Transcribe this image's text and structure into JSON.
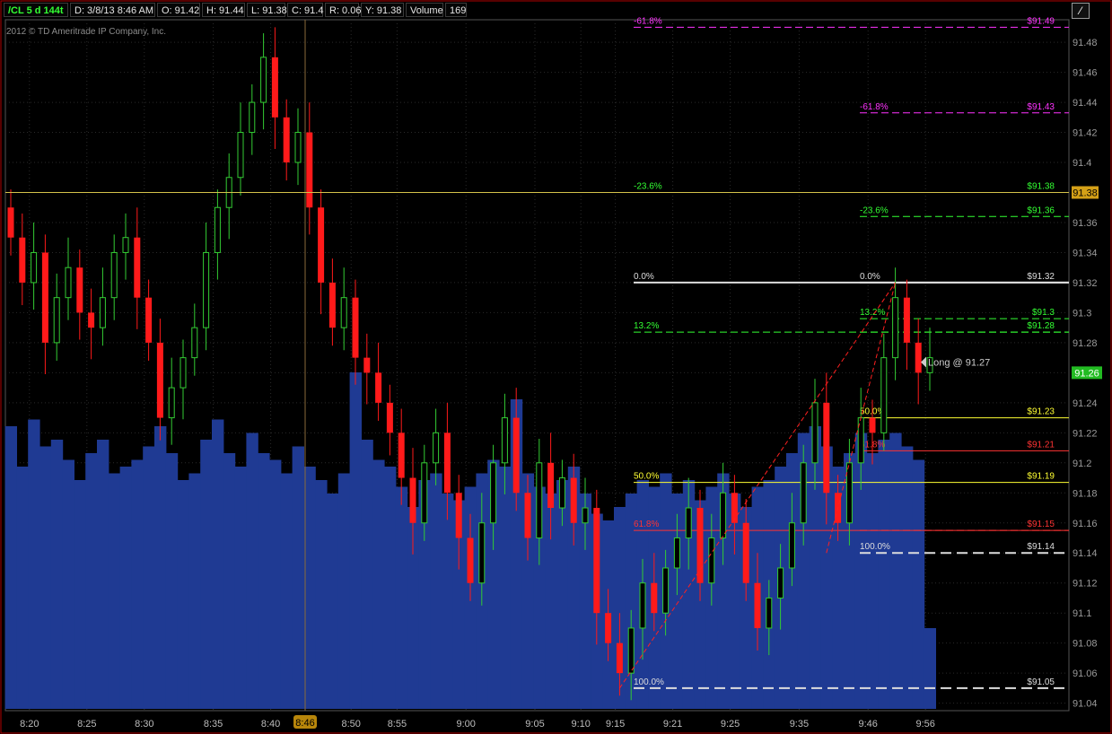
{
  "header": {
    "symbol": "/CL 5 d 144t",
    "fields": [
      "D: 3/8/13 8:46 AM",
      "O: 91.42",
      "H: 91.44",
      "L: 91.38",
      "C: 91.4",
      "R: 0.06",
      "Y: 91.38",
      "Volume",
      "169"
    ]
  },
  "copyright": "2012 © TD Ameritrade IP Company, Inc.",
  "chart_data": {
    "type": "candlestick",
    "y_range": [
      91.035,
      91.495
    ],
    "y_ticks": [
      "91.48",
      "91.46",
      "91.44",
      "91.42",
      "91.4",
      "91.38",
      "91.36",
      "91.34",
      "91.32",
      "91.3",
      "91.28",
      "91.26",
      "91.24",
      "91.22",
      "91.2",
      "91.18",
      "91.16",
      "91.14",
      "91.12",
      "91.1",
      "91.08",
      "91.06",
      "91.04"
    ],
    "x_ticks": [
      "8:20",
      "8:25",
      "8:30",
      "8:35",
      "8:40",
      "8:50",
      "8:55",
      "9:00",
      "9:05",
      "9:10",
      "9:15",
      "9:21",
      "9:25",
      "9:35",
      "9:46",
      "9:56"
    ],
    "cursor_time": "8:46",
    "last_price": "91.38",
    "position_price": "91.26",
    "annotation": "Long @ 91.27",
    "colors": {
      "up": "#33cc33",
      "down": "#ff1a1a",
      "volume": "#1f3a93",
      "background": "#000000"
    },
    "closes": [
      91.35,
      91.32,
      91.34,
      91.28,
      91.31,
      91.33,
      91.3,
      91.29,
      91.31,
      91.34,
      91.35,
      91.31,
      91.28,
      91.23,
      91.25,
      91.27,
      91.29,
      91.34,
      91.37,
      91.39,
      91.42,
      91.44,
      91.47,
      91.43,
      91.4,
      91.42,
      91.37,
      91.32,
      91.29,
      91.31,
      91.27,
      91.26,
      91.24,
      91.22,
      91.19,
      91.16,
      91.2,
      91.22,
      91.18,
      91.15,
      91.12,
      91.16,
      91.2,
      91.23,
      91.18,
      91.15,
      91.2,
      91.17,
      91.19,
      91.16,
      91.17,
      91.1,
      91.08,
      91.06,
      91.09,
      91.12,
      91.1,
      91.13,
      91.15,
      91.17,
      91.12,
      91.15,
      91.18,
      91.16,
      91.12,
      91.09,
      91.11,
      91.13,
      91.16,
      91.2,
      91.24,
      91.18,
      91.16,
      91.2,
      91.23,
      91.22,
      91.27,
      91.31,
      91.28,
      91.26,
      91.27
    ],
    "volumes": [
      210,
      180,
      215,
      195,
      200,
      185,
      170,
      190,
      200,
      175,
      180,
      185,
      195,
      210,
      190,
      170,
      175,
      200,
      215,
      190,
      180,
      205,
      190,
      185,
      175,
      195,
      180,
      170,
      160,
      175,
      250,
      200,
      185,
      180,
      165,
      150,
      170,
      175,
      160,
      155,
      165,
      175,
      185,
      180,
      230,
      175,
      165,
      160,
      170,
      180,
      160,
      145,
      140,
      150,
      160,
      170,
      165,
      175,
      160,
      170,
      155,
      165,
      175,
      160,
      150,
      165,
      170,
      180,
      190,
      205,
      210,
      195,
      180,
      190,
      205,
      190,
      200,
      205,
      195,
      185,
      60
    ],
    "fib_left": {
      "levels": [
        {
          "pct": "-61.8%",
          "price": "$91.49",
          "color": "#ff33ff"
        },
        {
          "pct": "-23.6%",
          "price": "$91.38",
          "color": "#33ff33"
        },
        {
          "pct": "0.0%",
          "price": "$91.32",
          "color": "#dddddd"
        },
        {
          "pct": "13.2%",
          "price": "",
          "color": "#33ff33"
        },
        {
          "pct": "50.0%",
          "price": "$91.19",
          "color": "#ffff33"
        },
        {
          "pct": "61.8%",
          "price": "",
          "color": "#ff3333"
        },
        {
          "pct": "100.0%",
          "price": "$91.05",
          "color": "#dddddd"
        }
      ],
      "values": [
        91.49,
        91.38,
        91.32,
        91.287,
        91.187,
        91.155,
        91.05
      ]
    },
    "fib_right": {
      "levels": [
        {
          "pct": "-61.8%",
          "price": "$91.43",
          "color": "#ff33ff"
        },
        {
          "pct": "-23.6%",
          "price": "$91.36",
          "color": "#33ff33"
        },
        {
          "pct": "0.0%",
          "price": "",
          "color": "#dddddd"
        },
        {
          "pct": "13.2%",
          "price": "$91.3",
          "color": "#33ff33"
        },
        {
          "pct": "",
          "price": "$91.28",
          "color": "#33ff33"
        },
        {
          "pct": "50.0%",
          "price": "$91.23",
          "color": "#ffff33"
        },
        {
          "pct": "61.8%",
          "price": "$91.21",
          "color": "#ff3333"
        },
        {
          "pct": "",
          "price": "$91.15",
          "color": "#ff3333"
        },
        {
          "pct": "100.0%",
          "price": "$91.14",
          "color": "#dddddd"
        }
      ],
      "values": [
        91.433,
        91.364,
        91.32,
        91.296,
        91.287,
        91.23,
        91.208,
        91.155,
        91.14
      ]
    }
  }
}
